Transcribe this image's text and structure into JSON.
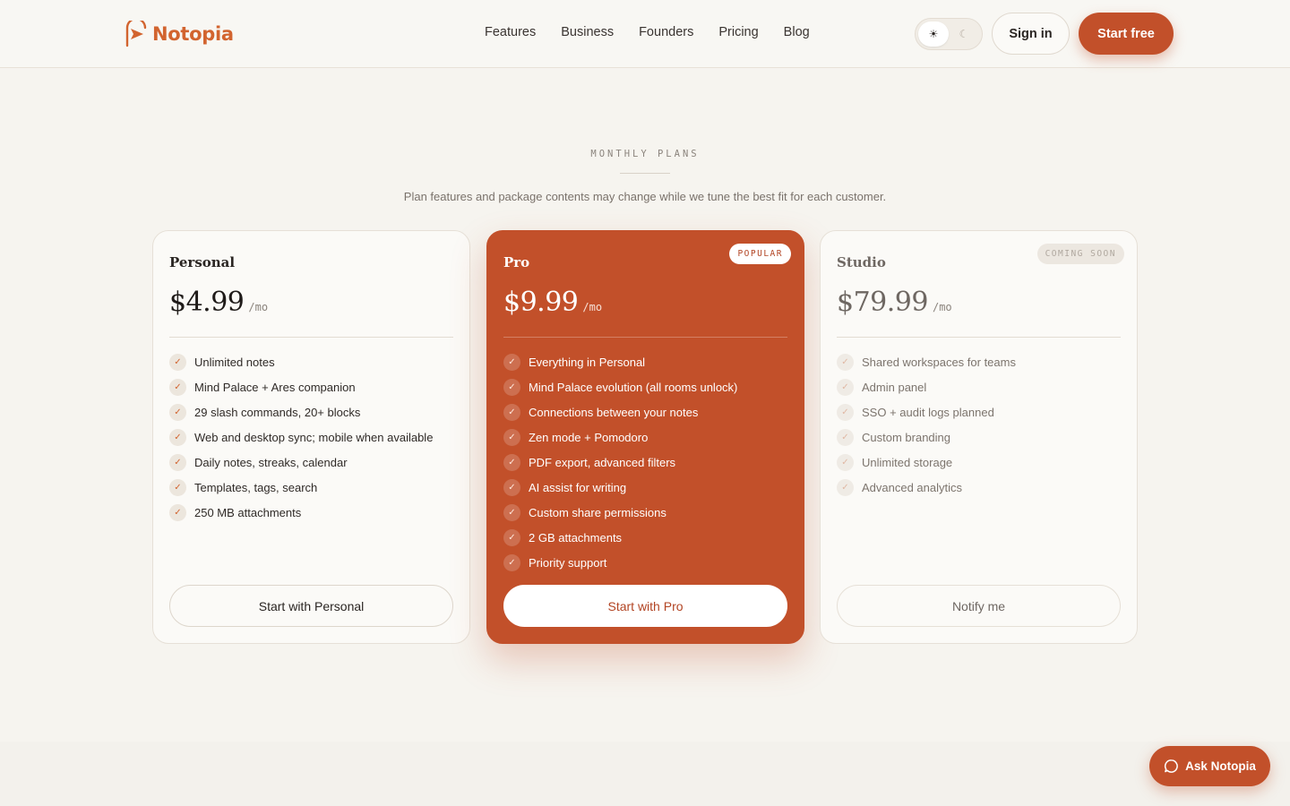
{
  "header": {
    "logo_text": "Notopia",
    "nav": [
      "Features",
      "Business",
      "Founders",
      "Pricing",
      "Blog"
    ],
    "theme": {
      "light_icon": "☀",
      "dark_icon": "☾",
      "active": "light"
    },
    "signin_label": "Sign in",
    "start_label": "Start free"
  },
  "section": {
    "eyebrow": "MONTHLY PLANS",
    "subtitle": "Plan features and package contents may change while we tune the best fit for each customer."
  },
  "plans": [
    {
      "name": "Personal",
      "price": "$4.99",
      "per": "/mo",
      "features": [
        "Unlimited notes",
        "Mind Palace + Ares companion",
        "29 slash commands, 20+ blocks",
        "Web and desktop sync; mobile when available",
        "Daily notes, streaks, calendar",
        "Templates, tags, search",
        "250 MB attachments"
      ],
      "cta": "Start with Personal"
    },
    {
      "name": "Pro",
      "price": "$9.99",
      "per": "/mo",
      "badge": "POPULAR",
      "features": [
        "Everything in Personal",
        "Mind Palace evolution (all rooms unlock)",
        "Connections between your notes",
        "Zen mode + Pomodoro",
        "PDF export, advanced filters",
        "AI assist for writing",
        "Custom share permissions",
        "2 GB attachments",
        "Priority support"
      ],
      "cta": "Start with Pro"
    },
    {
      "name": "Studio",
      "price": "$79.99",
      "per": "/mo",
      "badge": "COMING SOON",
      "features": [
        "Shared workspaces for teams",
        "Admin panel",
        "SSO + audit logs planned",
        "Custom branding",
        "Unlimited storage",
        "Advanced analytics"
      ],
      "cta": "Notify me"
    }
  ],
  "check_glyph": "✓",
  "assistant": {
    "label": "Ask Notopia",
    "icon": "chat-bubble-icon"
  },
  "colors": {
    "accent": "#c2502a",
    "logo": "#d2642f",
    "background": "#f6f4ef"
  }
}
